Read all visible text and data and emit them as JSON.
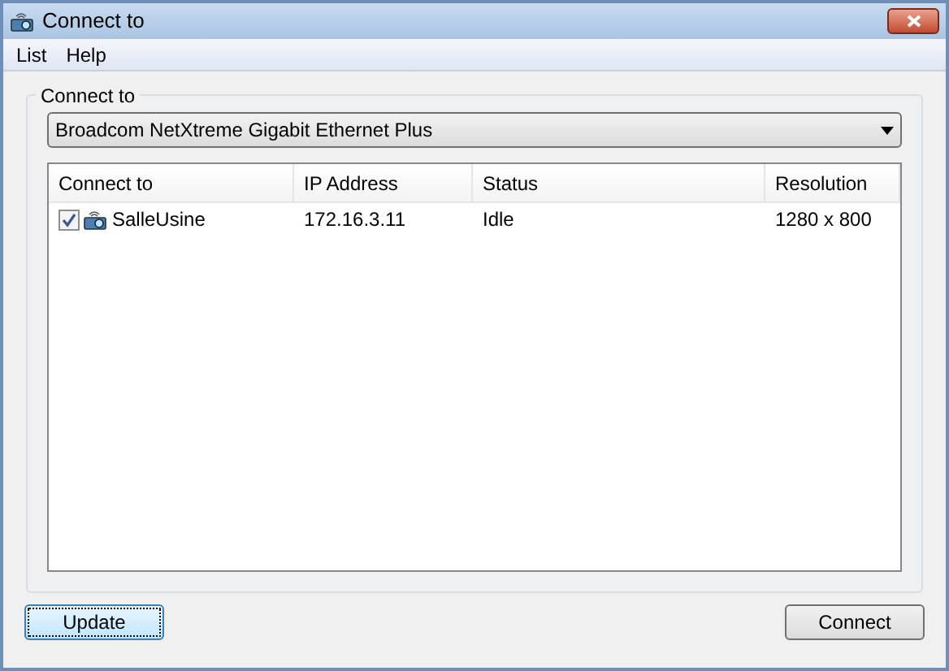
{
  "window": {
    "title": "Connect to"
  },
  "menu": [
    "List",
    "Help"
  ],
  "group": {
    "label": "Connect to",
    "adapter": "Broadcom NetXtreme Gigabit Ethernet Plus"
  },
  "table": {
    "columns": [
      "Connect to",
      "IP Address",
      "Status",
      "Resolution"
    ],
    "rows": [
      {
        "checked": true,
        "cells": [
          "SalleUsine",
          "172.16.3.11",
          "Idle",
          "1280 x 800"
        ]
      }
    ]
  },
  "buttons": [
    {
      "label": "Update",
      "focused": true
    },
    {
      "label": "Connect",
      "focused": false
    }
  ]
}
